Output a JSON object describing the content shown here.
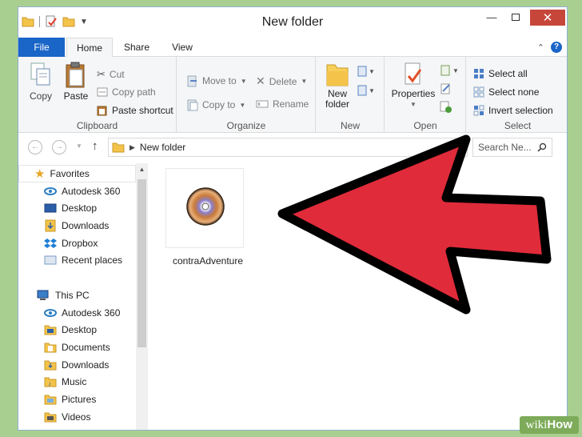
{
  "window": {
    "title": "New folder"
  },
  "tabs": [
    {
      "label": "File"
    },
    {
      "label": "Home"
    },
    {
      "label": "Share"
    },
    {
      "label": "View"
    }
  ],
  "ribbon": {
    "clipboard": {
      "label": "Clipboard",
      "copy": "Copy",
      "paste": "Paste",
      "cut": "Cut",
      "copy_path": "Copy path",
      "paste_shortcut": "Paste shortcut"
    },
    "organize": {
      "label": "Organize",
      "move_to": "Move to",
      "copy_to": "Copy to",
      "delete": "Delete",
      "rename": "Rename"
    },
    "new": {
      "label": "New",
      "new_folder_line1": "New",
      "new_folder_line2": "folder"
    },
    "open": {
      "label": "Open",
      "properties": "Properties"
    },
    "select": {
      "label": "Select",
      "select_all": "Select all",
      "select_none": "Select none",
      "invert_selection": "Invert selection"
    }
  },
  "address": {
    "path": "New folder"
  },
  "search": {
    "placeholder": "Search Ne..."
  },
  "navpane": {
    "favorites": {
      "label": "Favorites",
      "items": [
        "Autodesk 360",
        "Desktop",
        "Downloads",
        "Dropbox",
        "Recent places"
      ]
    },
    "thispc": {
      "label": "This PC",
      "items": [
        "Autodesk 360",
        "Desktop",
        "Documents",
        "Downloads",
        "Music",
        "Pictures",
        "Videos"
      ]
    }
  },
  "files": [
    {
      "name": "contraAdventure",
      "icon": "disc-image-icon"
    }
  ],
  "watermark": {
    "prefix": "wiki",
    "suffix": "How"
  },
  "colors": {
    "accent": "#1a65c8",
    "arrow_fill": "#e02b3a",
    "arrow_stroke": "#000000",
    "background": "#a9cf90"
  }
}
